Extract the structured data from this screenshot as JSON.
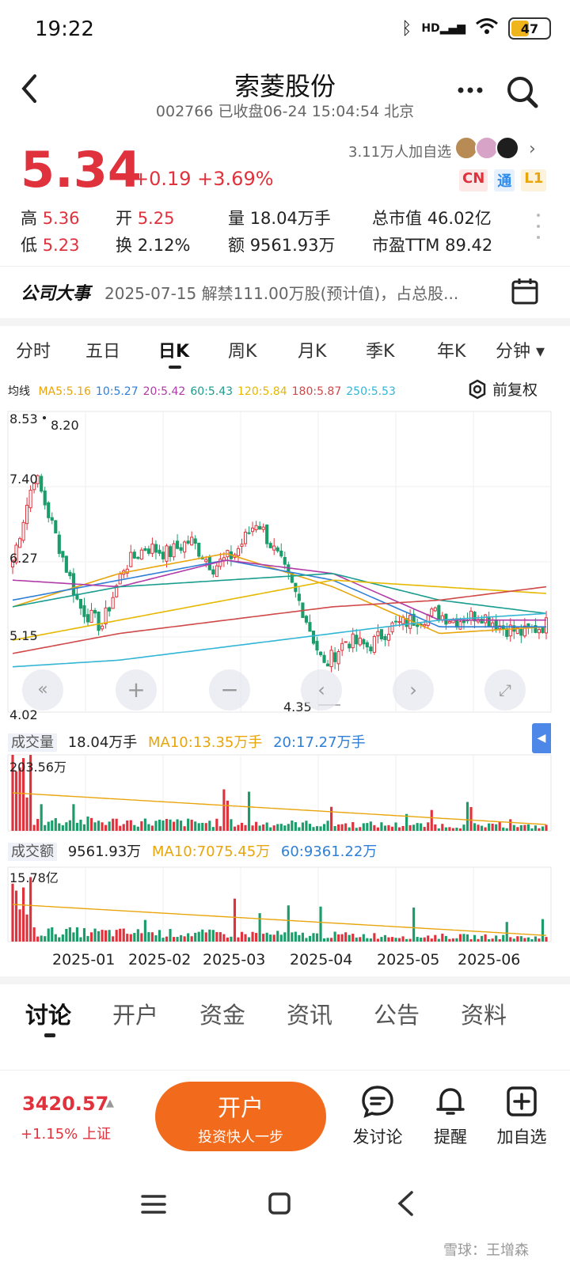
{
  "status": {
    "time": "19:22",
    "network": "HD",
    "battery": "47",
    "battery_level": 0.47
  },
  "header": {
    "title": "索菱股份",
    "subtitle": "002766 已收盘06-24 15:04:54 北京"
  },
  "quote": {
    "price": "5.34",
    "change": "+0.19 +3.69%",
    "followers": "3.11万人加自选",
    "badges": [
      "CN",
      "通",
      "L1"
    ],
    "high_label": "高",
    "high": "5.36",
    "low_label": "低",
    "low": "5.23",
    "open_label": "开",
    "open": "5.25",
    "turnover_label": "换",
    "turnover": "2.12%",
    "volume_label": "量",
    "volume": "18.04万手",
    "amount_label": "额",
    "amount": "9561.93万",
    "mktcap_label": "总市值",
    "mktcap": "46.02亿",
    "pe_label": "市盈TTM",
    "pe": "89.42"
  },
  "news": {
    "title": "公司大事",
    "text": "2025-07-15 解禁111.00万股(预计值)，占总股..."
  },
  "kline_tabs": [
    "分时",
    "五日",
    "日K",
    "周K",
    "月K",
    "季K",
    "年K",
    "分钟 ▾"
  ],
  "kline_active": 2,
  "ma": {
    "label": "均线",
    "items": [
      {
        "text": "MA5:5.16",
        "color": "#e8a50c"
      },
      {
        "text": "10:5.27",
        "color": "#2f7fd6"
      },
      {
        "text": "20:5.42",
        "color": "#b03aa8"
      },
      {
        "text": "60:5.43",
        "color": "#1a9d8f"
      },
      {
        "text": "120:5.84",
        "color": "#e6b800"
      },
      {
        "text": "180:5.87",
        "color": "#d04848"
      },
      {
        "text": "250:5.53",
        "color": "#33b5d6"
      }
    ],
    "adjust": "前复权"
  },
  "price_axis": {
    "ticks": [
      "8.53",
      "7.40",
      "6.27",
      "5.15",
      "4.02"
    ],
    "high_marker": "8.20",
    "low_marker": "4.35"
  },
  "volume": {
    "title": "成交量",
    "value": "18.04万手",
    "ma10": "MA10:13.35万手",
    "ma20": "20:17.27万手",
    "max": "203.56万"
  },
  "amount": {
    "title": "成交额",
    "value": "9561.93万",
    "ma10": "MA10:7075.45万",
    "ma60": "60:9361.22万",
    "max": "15.78亿"
  },
  "dates": [
    "2025-01",
    "2025-02",
    "2025-03",
    "2025-04",
    "2025-05",
    "2025-06"
  ],
  "chart_data": {
    "type": "candlestick",
    "x": [
      "2025-01",
      "2025-02",
      "2025-03",
      "2025-04",
      "2025-05",
      "2025-06"
    ],
    "ylim": [
      4.02,
      8.53
    ],
    "series": [
      {
        "name": "MA5",
        "values": [
          5.6,
          6.1,
          6.4,
          5.9,
          5.2,
          5.3
        ]
      },
      {
        "name": "10",
        "values": [
          5.7,
          6.0,
          6.3,
          6.0,
          5.3,
          5.3
        ]
      },
      {
        "name": "20",
        "values": [
          6.0,
          5.9,
          6.3,
          6.1,
          5.4,
          5.4
        ]
      },
      {
        "name": "60",
        "values": [
          5.6,
          5.9,
          6.0,
          6.1,
          5.7,
          5.5
        ]
      },
      {
        "name": "120",
        "values": [
          5.1,
          5.4,
          5.7,
          6.0,
          5.9,
          5.8
        ]
      },
      {
        "name": "180",
        "values": [
          4.9,
          5.2,
          5.4,
          5.6,
          5.7,
          5.9
        ]
      },
      {
        "name": "250",
        "values": [
          4.7,
          4.8,
          5.0,
          5.2,
          5.4,
          5.5
        ]
      }
    ],
    "high": 8.53,
    "low": 4.02
  },
  "detail_tabs": [
    "讨论",
    "开户",
    "资金",
    "资讯",
    "公告",
    "资料"
  ],
  "detail_active": 0,
  "bottom": {
    "index_value": "3420.57",
    "index_change": "+1.15% 上证",
    "open_title": "开户",
    "open_sub": "投资快人一步",
    "actions": [
      "发讨论",
      "提醒",
      "加自选"
    ]
  },
  "watermark": "雪球：王增森",
  "colors": {
    "up": "#e0323c",
    "down": "#1a9d6a",
    "accent": "#f26b1d"
  }
}
